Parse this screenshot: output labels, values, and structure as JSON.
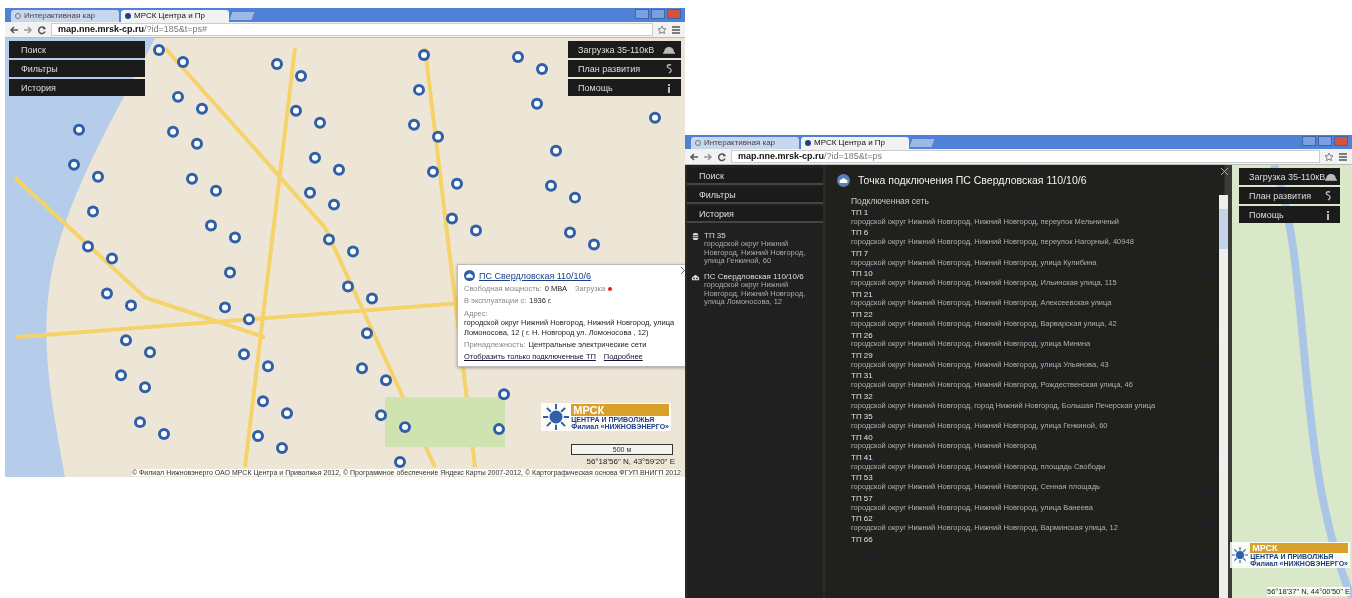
{
  "windows": [
    {
      "tabs": [
        {
          "label": "Интерактивная кар",
          "selected": false
        },
        {
          "label": "МРСК Центра и Пр",
          "selected": true
        }
      ],
      "url": {
        "host": "map.nne.mrsk-cp.ru",
        "path": "/?id=185&t=ps#"
      },
      "left_menu": [
        "Поиск",
        "Фильтры",
        "История"
      ],
      "right_menu": [
        {
          "label": "Загрузка 35-110кВ",
          "kind": "helmet"
        },
        {
          "label": "План развития",
          "kind": "paragraph"
        },
        {
          "label": "Помощь",
          "kind": "info"
        }
      ],
      "popup": {
        "title": "ПС Свердловская 110/10/6",
        "rows": [
          {
            "label": "Свободная мощность:",
            "value": "0 МВА",
            "extra": "Загрузка",
            "color": "#e02020"
          },
          {
            "label": "В эксплуатации с:",
            "value": "1936 г."
          },
          {
            "label": "Адрес:",
            "value": "городской округ Нижний Новгород, Нижний Новгород, улица Ломоносова, 12 ( г. Н. Новгород ул. Ломоносова , 12)"
          },
          {
            "label": "Принадлежность:",
            "value": "Центральные электрические сети"
          }
        ],
        "links": [
          "Отобразить только подключенные ТП",
          "Подробнее"
        ]
      },
      "logo": {
        "name": "МРСК",
        "line2": "ЦЕНТРА И ПРИВОЛЖЬЯ",
        "line3": "Филиал «НИЖНОВЭНЕРГО»"
      },
      "scale": "500 м",
      "coords": "56°18'56\" N, 43°59'20\" E",
      "copyright": "© Филиал Нижновэнерго ОАО МРСК Центра и Приволжья 2012, © Программное обеспечение Яндекс Карты 2007-2012, © Картографическая основа ФГУП ВНИГП 2012"
    },
    {
      "tabs": [
        {
          "label": "Интерактивная кар",
          "selected": false
        },
        {
          "label": "МРСК Центра и Пр",
          "selected": true
        }
      ],
      "url": {
        "host": "map.nne.mrsk-cp.ru",
        "path": "/?id=185&t=ps"
      },
      "left_menu": [
        "Поиск",
        "Фильтры",
        "История"
      ],
      "history": [
        {
          "name": "ТП 35",
          "address": "городской округ Нижний Новгород, Нижний Новгород, улица Генкиной, 60",
          "kind": "transformer"
        },
        {
          "name": "ПС Свердловская 110/10/6",
          "address": "городской округ Нижний Новгород, Нижний Новгород, улица Ломоносова, 12",
          "kind": "substation"
        }
      ],
      "right_menu": [
        {
          "label": "Загрузка 35-110кВ",
          "kind": "helmet"
        },
        {
          "label": "План развития",
          "kind": "paragraph"
        },
        {
          "label": "Помощь",
          "kind": "info"
        }
      ],
      "dialog": {
        "title": "Точка подключения ПС Свердловская 110/10/6",
        "section": "Подключенная сеть",
        "items": [
          {
            "name": "ТП 1",
            "address": "городской округ Нижний Новгород, Нижний Новгород, переулок Мельничный"
          },
          {
            "name": "ТП 6",
            "address": "городской округ Нижний Новгород, Нижний Новгород, переулок Нагорный, 40948"
          },
          {
            "name": "ТП 7",
            "address": "городской округ Нижний Новгород, Нижний Новгород, улица Кулибина"
          },
          {
            "name": "ТП 10",
            "address": "городской округ Нижний Новгород, Нижний Новгород, Ильинская улица, 115"
          },
          {
            "name": "ТП 21",
            "address": "городской округ Нижний Новгород, Нижний Новгород, Алексеевская улица"
          },
          {
            "name": "ТП 22",
            "address": "городской округ Нижний Новгород, Нижний Новгород, Варварская улица, 42"
          },
          {
            "name": "ТП 26",
            "address": "городской округ Нижний Новгород, Нижний Новгород, улица Минина"
          },
          {
            "name": "ТП 29",
            "address": "городской округ Нижний Новгород, Нижний Новгород, улица Ульянова, 43"
          },
          {
            "name": "ТП 31",
            "address": "городской округ Нижний Новгород, Нижний Новгород, Рождественская улица, 46"
          },
          {
            "name": "ТП 32",
            "address": "городской округ Нижний Новгород, город Нижний Новгород, Большая Печерская улица"
          },
          {
            "name": "ТП 35",
            "address": "городской округ Нижний Новгород, Нижний Новгород, улица Генкиной, 60"
          },
          {
            "name": "ТП 40",
            "address": "городской округ Нижний Новгород, Нижний Новгород"
          },
          {
            "name": "ТП 41",
            "address": "городской округ Нижний Новгород, Нижний Новгород, площадь Свободы"
          },
          {
            "name": "ТП 53",
            "address": "городской округ Нижний Новгород, Нижний Новгород, Сенная площадь"
          },
          {
            "name": "ТП 57",
            "address": "городской округ Нижний Новгород, Нижний Новгород, улица Ванеева"
          },
          {
            "name": "ТП 62",
            "address": "городской округ Нижний Новгород, Нижний Новгород, Варминская улица, 12"
          },
          {
            "name": "ТП 66"
          }
        ]
      },
      "logo": {
        "name": "МРСК",
        "line2": "ЦЕНТРА И ПРИВОЛЖЬЯ",
        "line3": "Филиал «НИЖНОВЭНЕРГО»"
      },
      "coords": "56°18'37\" N, 44°00'50\" E"
    }
  ]
}
